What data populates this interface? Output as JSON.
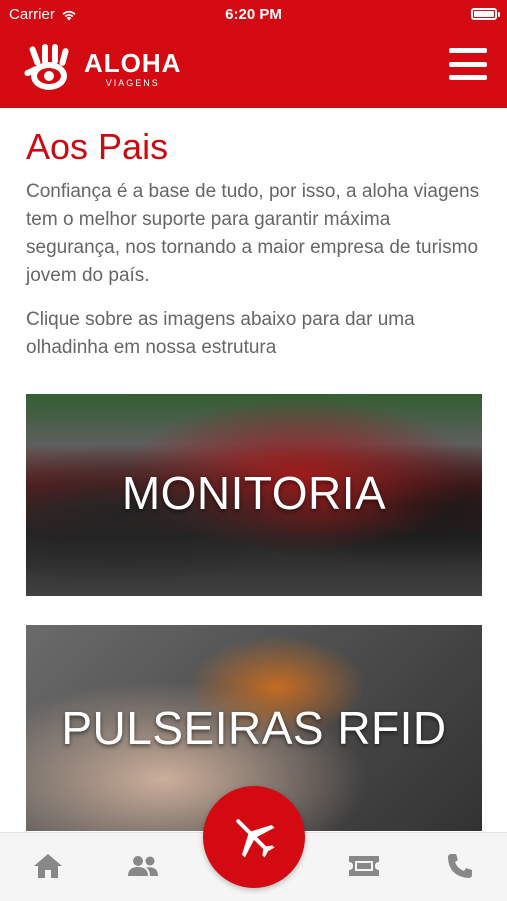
{
  "status_bar": {
    "carrier": "Carrier",
    "time": "6:20 PM"
  },
  "header": {
    "brand": "ALOHA",
    "brand_sub": "VIAGENS",
    "logo_icon": "hand-eye-logo",
    "menu_icon": "hamburger-menu-icon"
  },
  "main": {
    "title": "Aos Pais",
    "intro": "Confiança é a base de tudo, por isso, a aloha viagens tem o melhor suporte para garantir máxima segurança, nos tornando a maior empresa de turismo jovem do país.",
    "instruction": "Clique sobre as imagens abaixo para dar uma olhadinha em nossa estrutura",
    "cards": [
      {
        "label": "MONITORIA"
      },
      {
        "label": "PULSEIRAS RFID"
      }
    ]
  },
  "tabbar": {
    "items": [
      "home-icon",
      "people-icon",
      "airplane-icon",
      "ticket-icon",
      "phone-icon"
    ]
  },
  "colors": {
    "brand_red": "#d40a12",
    "text_gray": "#666666",
    "icon_gray": "#888888"
  }
}
